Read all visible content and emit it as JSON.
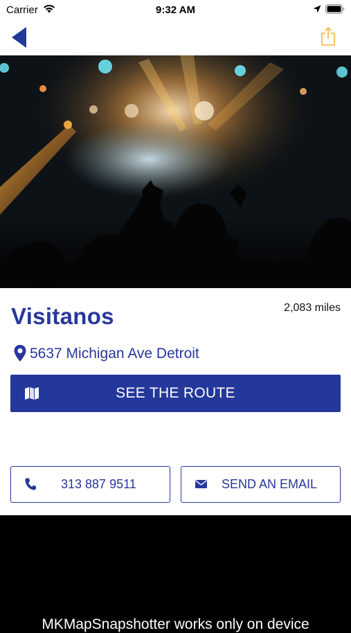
{
  "status_bar": {
    "carrier": "Carrier",
    "time": "9:32 AM",
    "icons": [
      "wifi-icon",
      "location-arrow-icon",
      "battery-icon"
    ]
  },
  "nav": {
    "back_icon": "chevron-left-icon",
    "share_icon": "share-icon",
    "accent_color": "#24379a",
    "share_color": "#f1b43c"
  },
  "venue": {
    "name": "Visitanos",
    "distance": "2,083 miles",
    "address": "5637 Michigan Ave Detroit"
  },
  "actions": {
    "route_label": "SEE THE ROUTE",
    "phone_label": "313 887 9511",
    "email_label": "SEND AN EMAIL"
  },
  "map": {
    "notice": "MKMapSnapshotter works only on device"
  }
}
